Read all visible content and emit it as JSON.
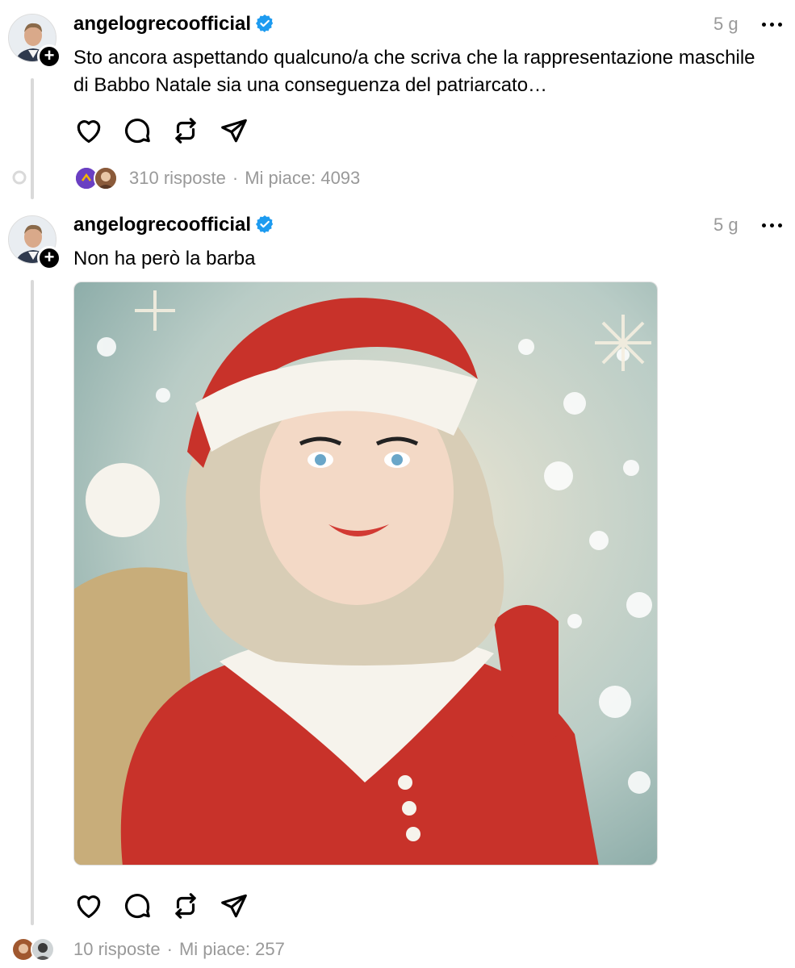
{
  "posts": [
    {
      "username": "angelogrecoofficial",
      "time": "5 g",
      "text": "Sto ancora aspettando qualcuno/a che scriva che la rappresentazione maschile di Babbo Natale sia una conseguenza del patriarcato…",
      "replies": "310 risposte",
      "likes": "Mi piace: 4093"
    },
    {
      "username": "angelogrecoofficial",
      "time": "5 g",
      "text": "Non ha però la barba",
      "replies": "10 risposte",
      "likes": "Mi piace: 257"
    }
  ],
  "meta_separator": "·",
  "icons": {
    "like": "heart-icon",
    "reply": "comment-icon",
    "repost": "repost-icon",
    "share": "send-icon",
    "verified": "verified-badge-icon",
    "more": "more-icon",
    "follow": "plus-icon"
  },
  "colors": {
    "verified": "#1d9bf0",
    "meta_text": "#999999",
    "thread_line": "#d9d9d9"
  }
}
